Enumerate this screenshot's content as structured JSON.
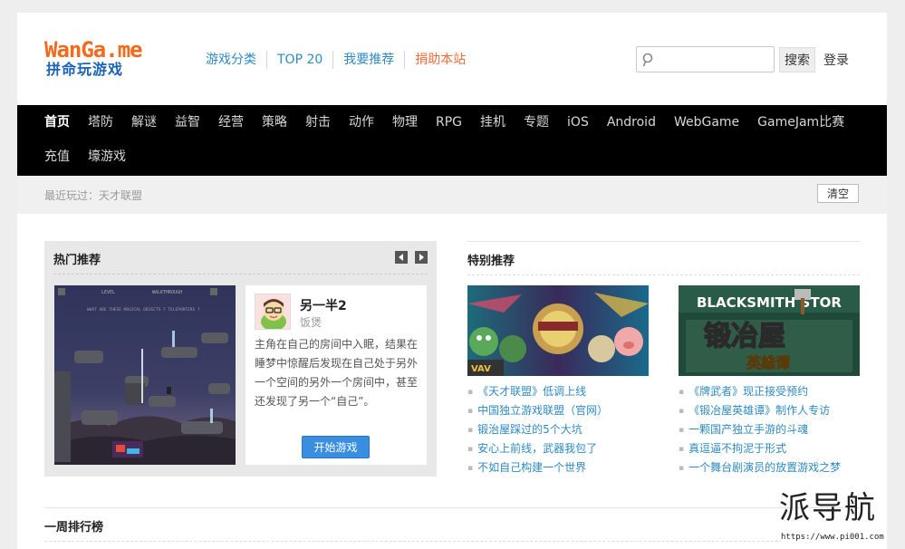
{
  "logo": {
    "en": "WanGa.me",
    "cn": "拼命玩游戏"
  },
  "topnav": [
    "游戏分类",
    "TOP 20",
    "我要推荐",
    "捐助本站"
  ],
  "search": {
    "placeholder": "",
    "button": "搜索"
  },
  "login": "登录",
  "mainnav": [
    "首页",
    "塔防",
    "解谜",
    "益智",
    "经营",
    "策略",
    "射击",
    "动作",
    "物理",
    "RPG",
    "挂机",
    "专题",
    "iOS",
    "Android",
    "WebGame",
    "GameJam比赛",
    "充值",
    "壕游戏"
  ],
  "recent": {
    "label": "最近玩过：",
    "game": "天才联盟",
    "clear": "清空"
  },
  "hot": {
    "title": "热门推荐",
    "screenshot_text": [
      "LEVEL",
      "WALKTHROUGH",
      "WHAT ARE THESE MAGICAL OBJECTS ? TELEPORTERS ?"
    ],
    "game_name": "另一半2",
    "author": "饭煲",
    "desc": "主角在自己的房间中入眠，结果在睡梦中惊醒后发现在自己处于另外一个空间的另外一个房间中，甚至还发现了另一个“自己”。",
    "play": "开始游戏"
  },
  "special": {
    "title": "特别推荐",
    "left_links": [
      "《天才联盟》低调上线",
      "中国独立游戏联盟（官网）",
      "锻治屋踩过的5个大坑",
      "安心上前线，武器我包了",
      "不如自己构建一个世界"
    ],
    "right_image_text": [
      "BLACKSMITH STOR",
      "锻冶屋",
      "英雄谭"
    ],
    "right_links": [
      "《牌武者》现正接受预约",
      "《锻冶屋英雄谭》制作人专访",
      "一颗国产独立手游的斗魂",
      "真逗逼不拘泥于形式",
      "一个舞台剧演员的放置游戏之梦"
    ]
  },
  "weekly": {
    "title": "一周排行榜"
  },
  "watermark": {
    "big": "派导航",
    "url": "https://www.pi001.com"
  },
  "colors": {
    "accent_blue": "#2f8ac2",
    "donate_orange": "#ef6b3a",
    "logo_orange": "#f26a1b",
    "logo_blue": "#1a63b8",
    "nav_bg": "#000000",
    "button_blue": "#3a8ee0"
  }
}
